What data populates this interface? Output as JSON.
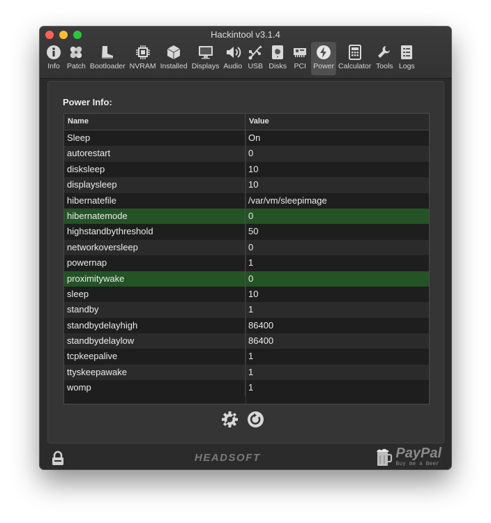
{
  "window": {
    "title": "Hackintool v3.1.4"
  },
  "toolbar": {
    "items": [
      {
        "label": "Info",
        "icon": "info-icon"
      },
      {
        "label": "Patch",
        "icon": "bandage-icon"
      },
      {
        "label": "Bootloader",
        "icon": "boot-icon"
      },
      {
        "label": "NVRAM",
        "icon": "chip-icon"
      },
      {
        "label": "Installed",
        "icon": "box-icon"
      },
      {
        "label": "Displays",
        "icon": "monitor-icon"
      },
      {
        "label": "Audio",
        "icon": "speaker-icon"
      },
      {
        "label": "USB",
        "icon": "usb-icon"
      },
      {
        "label": "Disks",
        "icon": "disk-icon"
      },
      {
        "label": "PCI",
        "icon": "pci-card-icon"
      },
      {
        "label": "Power",
        "icon": "power-icon",
        "active": true
      },
      {
        "label": "Calculator",
        "icon": "calculator-icon"
      },
      {
        "label": "Tools",
        "icon": "wrench-icon"
      },
      {
        "label": "Logs",
        "icon": "log-list-icon"
      }
    ]
  },
  "power": {
    "title": "Power Info:",
    "columns": [
      "Name",
      "Value"
    ],
    "rows": [
      {
        "name": "Sleep",
        "value": "On",
        "highlight": false
      },
      {
        "name": "autorestart",
        "value": "0",
        "highlight": false
      },
      {
        "name": "disksleep",
        "value": "10",
        "highlight": false
      },
      {
        "name": "displaysleep",
        "value": "10",
        "highlight": false
      },
      {
        "name": "hibernatefile",
        "value": "/var/vm/sleepimage",
        "highlight": false
      },
      {
        "name": "hibernatemode",
        "value": "0",
        "highlight": true
      },
      {
        "name": "highstandbythreshold",
        "value": "50",
        "highlight": false
      },
      {
        "name": "networkoversleep",
        "value": "0",
        "highlight": false
      },
      {
        "name": "powernap",
        "value": "1",
        "highlight": false
      },
      {
        "name": "proximitywake",
        "value": "0",
        "highlight": true
      },
      {
        "name": "sleep",
        "value": "10",
        "highlight": false
      },
      {
        "name": "standby",
        "value": "1",
        "highlight": false
      },
      {
        "name": "standbydelayhigh",
        "value": "86400",
        "highlight": false
      },
      {
        "name": "standbydelaylow",
        "value": "86400",
        "highlight": false
      },
      {
        "name": "tcpkeepalive",
        "value": "1",
        "highlight": false
      },
      {
        "name": "ttyskeepawake",
        "value": "1",
        "highlight": false
      },
      {
        "name": "womp",
        "value": "1",
        "highlight": false
      }
    ],
    "highlight_color": "#245326"
  },
  "actions": [
    {
      "icon": "gear-fix-icon"
    },
    {
      "icon": "refresh-icon"
    }
  ],
  "footer": {
    "lock_icon": "lock-icon",
    "brand": "HEADSOFT",
    "paypal_logo": "PayPal",
    "paypal_sub": "Buy me a Beer",
    "beer_icon": "beer-mug-icon"
  }
}
